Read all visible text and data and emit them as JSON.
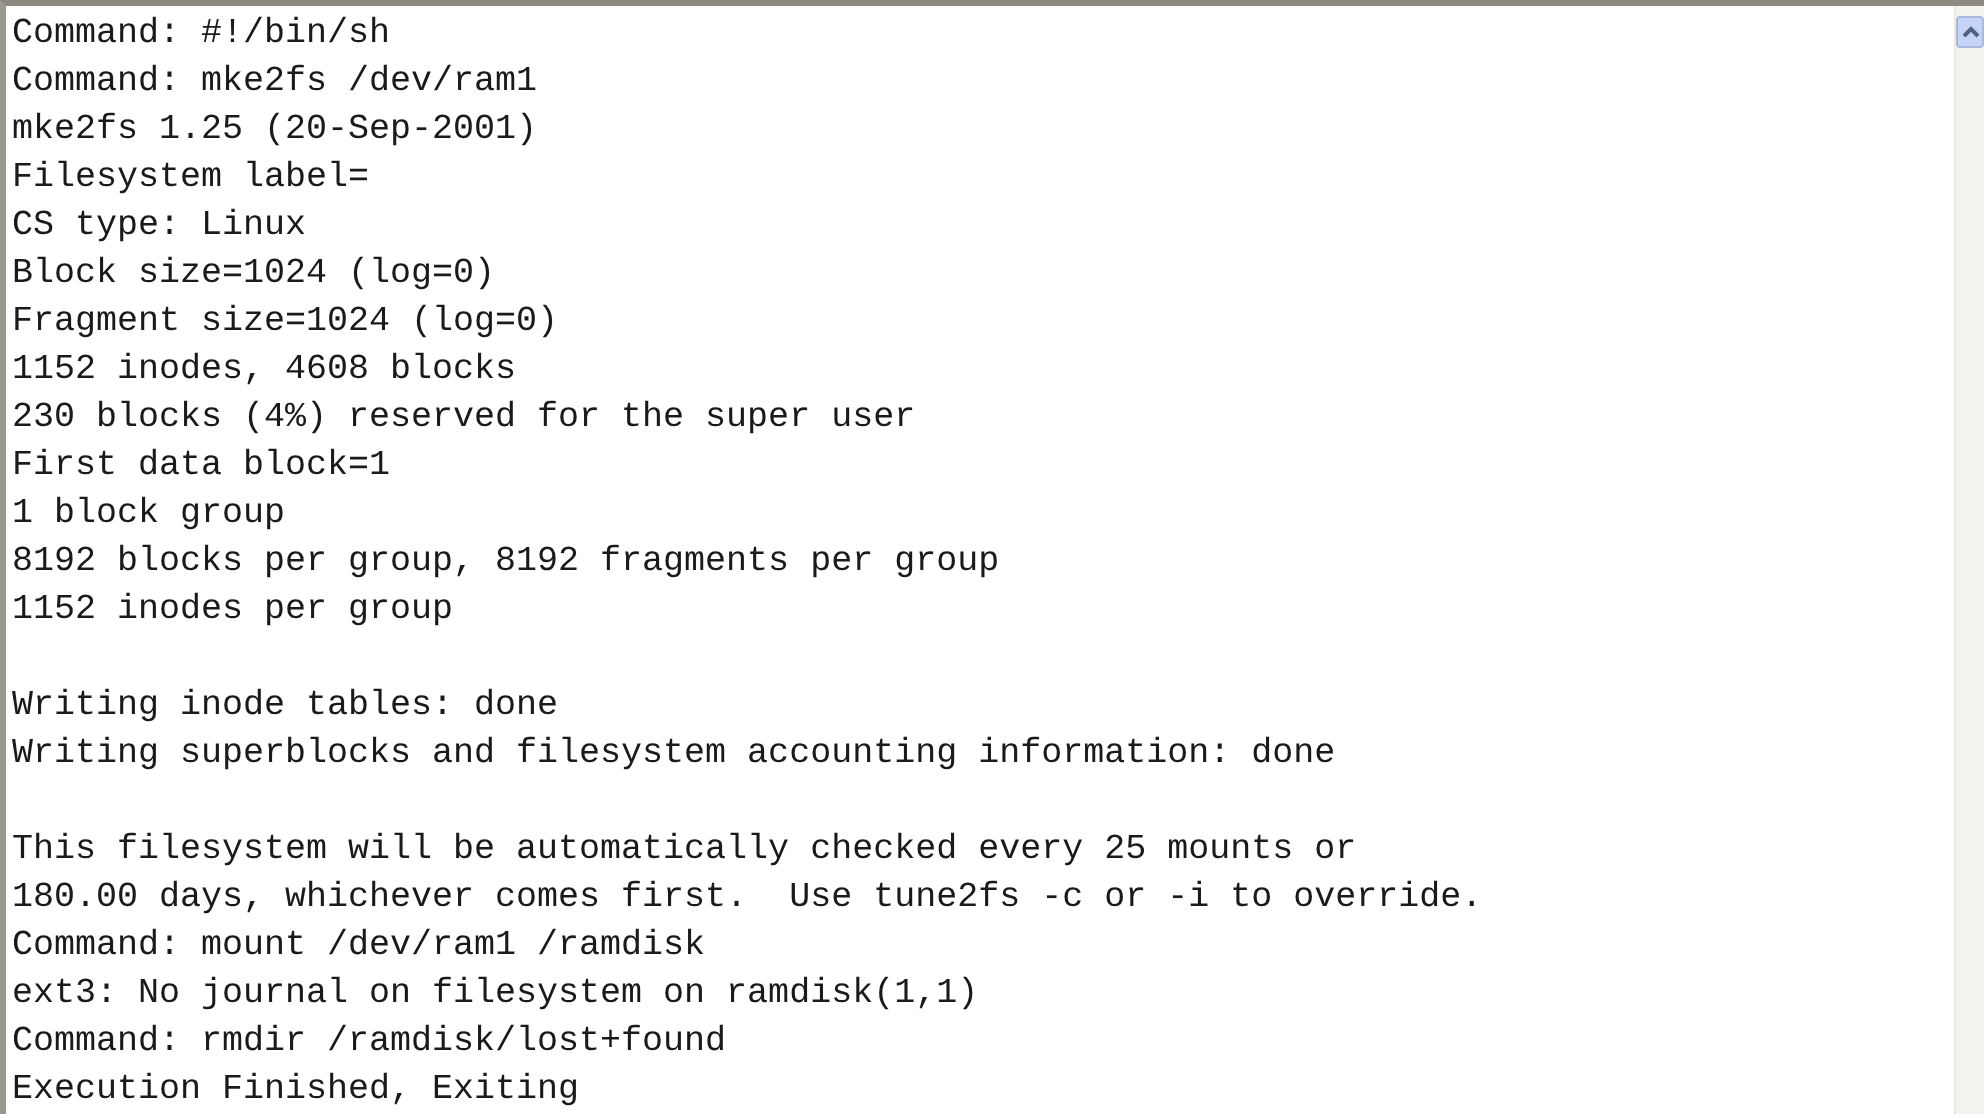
{
  "console": {
    "blocks": [
      [
        "Command: #!/bin/sh",
        "Command: mke2fs /dev/ram1",
        "mke2fs 1.25 (20-Sep-2001)",
        "Filesystem label=",
        "CS type: Linux",
        "Block size=1024 (log=0)",
        "Fragment size=1024 (log=0)",
        "1152 inodes, 4608 blocks",
        "230 blocks (4%) reserved for the super user",
        "First data block=1",
        "1 block group",
        "8192 blocks per group, 8192 fragments per group",
        "1152 inodes per group"
      ],
      [
        "Writing inode tables: done",
        "Writing superblocks and filesystem accounting information: done"
      ],
      [
        "This filesystem will be automatically checked every 25 mounts or",
        "180.00 days, whichever comes first.  Use tune2fs -c or -i to override.",
        "Command: mount /dev/ram1 /ramdisk",
        "ext3: No journal on filesystem on ramdisk(1,1)",
        "Command: rmdir /ramdisk/lost+found",
        "Execution Finished, Exiting"
      ]
    ]
  }
}
